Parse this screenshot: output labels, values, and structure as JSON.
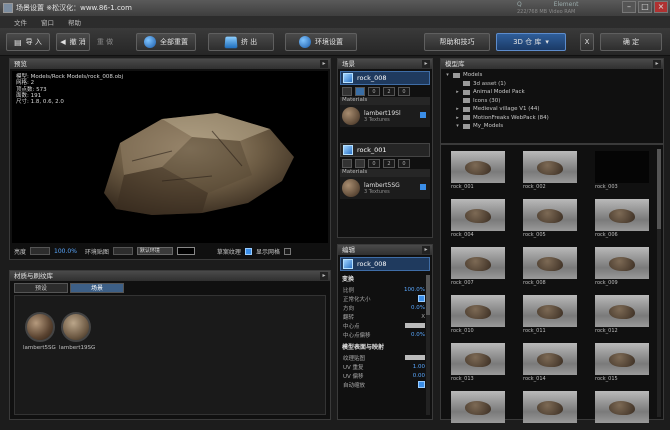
{
  "window": {
    "title": "场景设置 ※松汉化：www.86-1.com",
    "toolbar_info": [
      "Q",
      "Element"
    ],
    "vram": "222/768 MB Video RAM"
  },
  "menu": [
    "文件",
    "窗口",
    "帮助"
  ],
  "toolbar": {
    "import": "导 入",
    "undo": "撤 消",
    "redo": "重 做",
    "reset_all": "全部重置",
    "extrude": "挤 出",
    "env_settings": "环境设置",
    "help": "帮助和技巧",
    "library": "3D 仓 库",
    "close": "X",
    "confirm": "确 定"
  },
  "preview": {
    "title": "预览",
    "info": [
      "模型: Models/Rock Models/rock_008.obj",
      "网格: 2",
      "顶点数: 573",
      "面数: 191",
      "尺寸: 1.8, 0.6, 2.0"
    ],
    "brightness_label": "亮度",
    "brightness_value": "100.0%",
    "env_map_label": "环境贴图",
    "env_map_value": "默认环境",
    "grass_label": "草案纹理",
    "grid_label": "显示网格"
  },
  "materials": {
    "title": "材质与刷纹库",
    "tabs": [
      "预设",
      "场景"
    ],
    "items": [
      "lambert5SG",
      "lambert19SG"
    ]
  },
  "scene": {
    "title": "场景",
    "objects": [
      {
        "name": "rock_008",
        "materials_label": "Materials",
        "material": "lambert19Sl",
        "textures": "3 Textures",
        "counts": [
          "0",
          "2",
          "0"
        ]
      },
      {
        "name": "rock_001",
        "materials_label": "Materials",
        "material": "lambert5SG",
        "textures": "3 Textures",
        "counts": [
          "0",
          "2",
          "0"
        ]
      }
    ]
  },
  "edit": {
    "title": "编辑",
    "object": "rock_008",
    "transform_label": "变换",
    "props": [
      {
        "label": "比例",
        "value": "100.0%"
      },
      {
        "label": "正常化大小",
        "value": ""
      },
      {
        "label": "方向",
        "value": "0.0%"
      },
      {
        "label": "翻转",
        "value": "X"
      },
      {
        "label": "中心点",
        "value": ""
      },
      {
        "label": "中心点偏移",
        "value": "0.0%"
      }
    ],
    "surface_label": "模型表面与映射",
    "surface_props": [
      {
        "label": "纹理贴图",
        "value": ""
      },
      {
        "label": "UV 重复",
        "value": "1.00"
      },
      {
        "label": "UV 偏移",
        "value": "0.00"
      },
      {
        "label": "自动缩放",
        "value": ""
      }
    ]
  },
  "library": {
    "title": "模型库",
    "tree": [
      {
        "label": "Models",
        "level": 0
      },
      {
        "label": "3d asset (1)",
        "level": 1
      },
      {
        "label": "Animal Model Pack",
        "level": 1
      },
      {
        "label": "Icons (30)",
        "level": 1
      },
      {
        "label": "Medieval village V1 (44)",
        "level": 1
      },
      {
        "label": "MotionFreaks WebPack (84)",
        "level": 1
      },
      {
        "label": "My_Models",
        "level": 1
      }
    ]
  },
  "grid": {
    "title": "模型库",
    "items": [
      "rock_001",
      "rock_002",
      "rock_003",
      "rock_004",
      "rock_005",
      "rock_006",
      "rock_007",
      "rock_008",
      "rock_009",
      "rock_010",
      "rock_011",
      "rock_012",
      "rock_013",
      "rock_014",
      "rock_015",
      "",
      "",
      ""
    ]
  },
  "colors": {
    "accent": "#3b8ee8",
    "value_blue": "#5aa8ff",
    "selected_object": "#1f3a5e"
  }
}
